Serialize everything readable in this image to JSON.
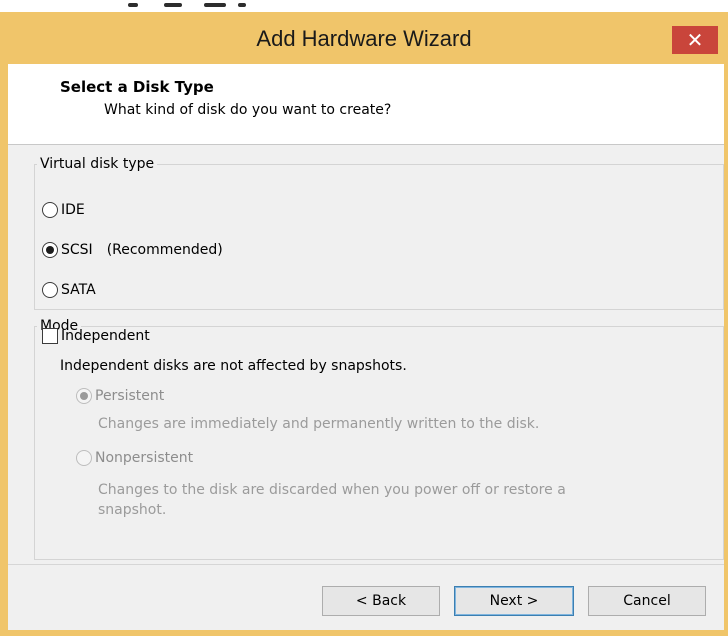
{
  "window": {
    "title": "Add Hardware Wizard",
    "close_glyph": "✕"
  },
  "header": {
    "title": "Select a Disk Type",
    "subtitle": "What kind of disk do you want to create?"
  },
  "disk_type": {
    "legend": "Virtual disk type",
    "options": [
      {
        "label": "IDE",
        "checked": false
      },
      {
        "label": "SCSI",
        "checked": true,
        "note": "(Recommended)"
      },
      {
        "label": "SATA",
        "checked": false
      }
    ]
  },
  "mode": {
    "legend": "Mode",
    "independent_label": "Independent",
    "independent_checked": false,
    "independent_note": "Independent disks are not affected by snapshots.",
    "persistent_label": "Persistent",
    "persistent_desc": "Changes are immediately and permanently written to the disk.",
    "nonpersistent_label": "Nonpersistent",
    "nonpersistent_desc_line1": "Changes to the disk are discarded when you power off or restore a",
    "nonpersistent_desc_line2": "snapshot."
  },
  "buttons": {
    "back": "< Back",
    "next": "Next >",
    "cancel": "Cancel"
  },
  "colors": {
    "title_bar": "#f0c56a",
    "close_button": "#c9453b",
    "dialog_body": "#f0f0f0"
  }
}
